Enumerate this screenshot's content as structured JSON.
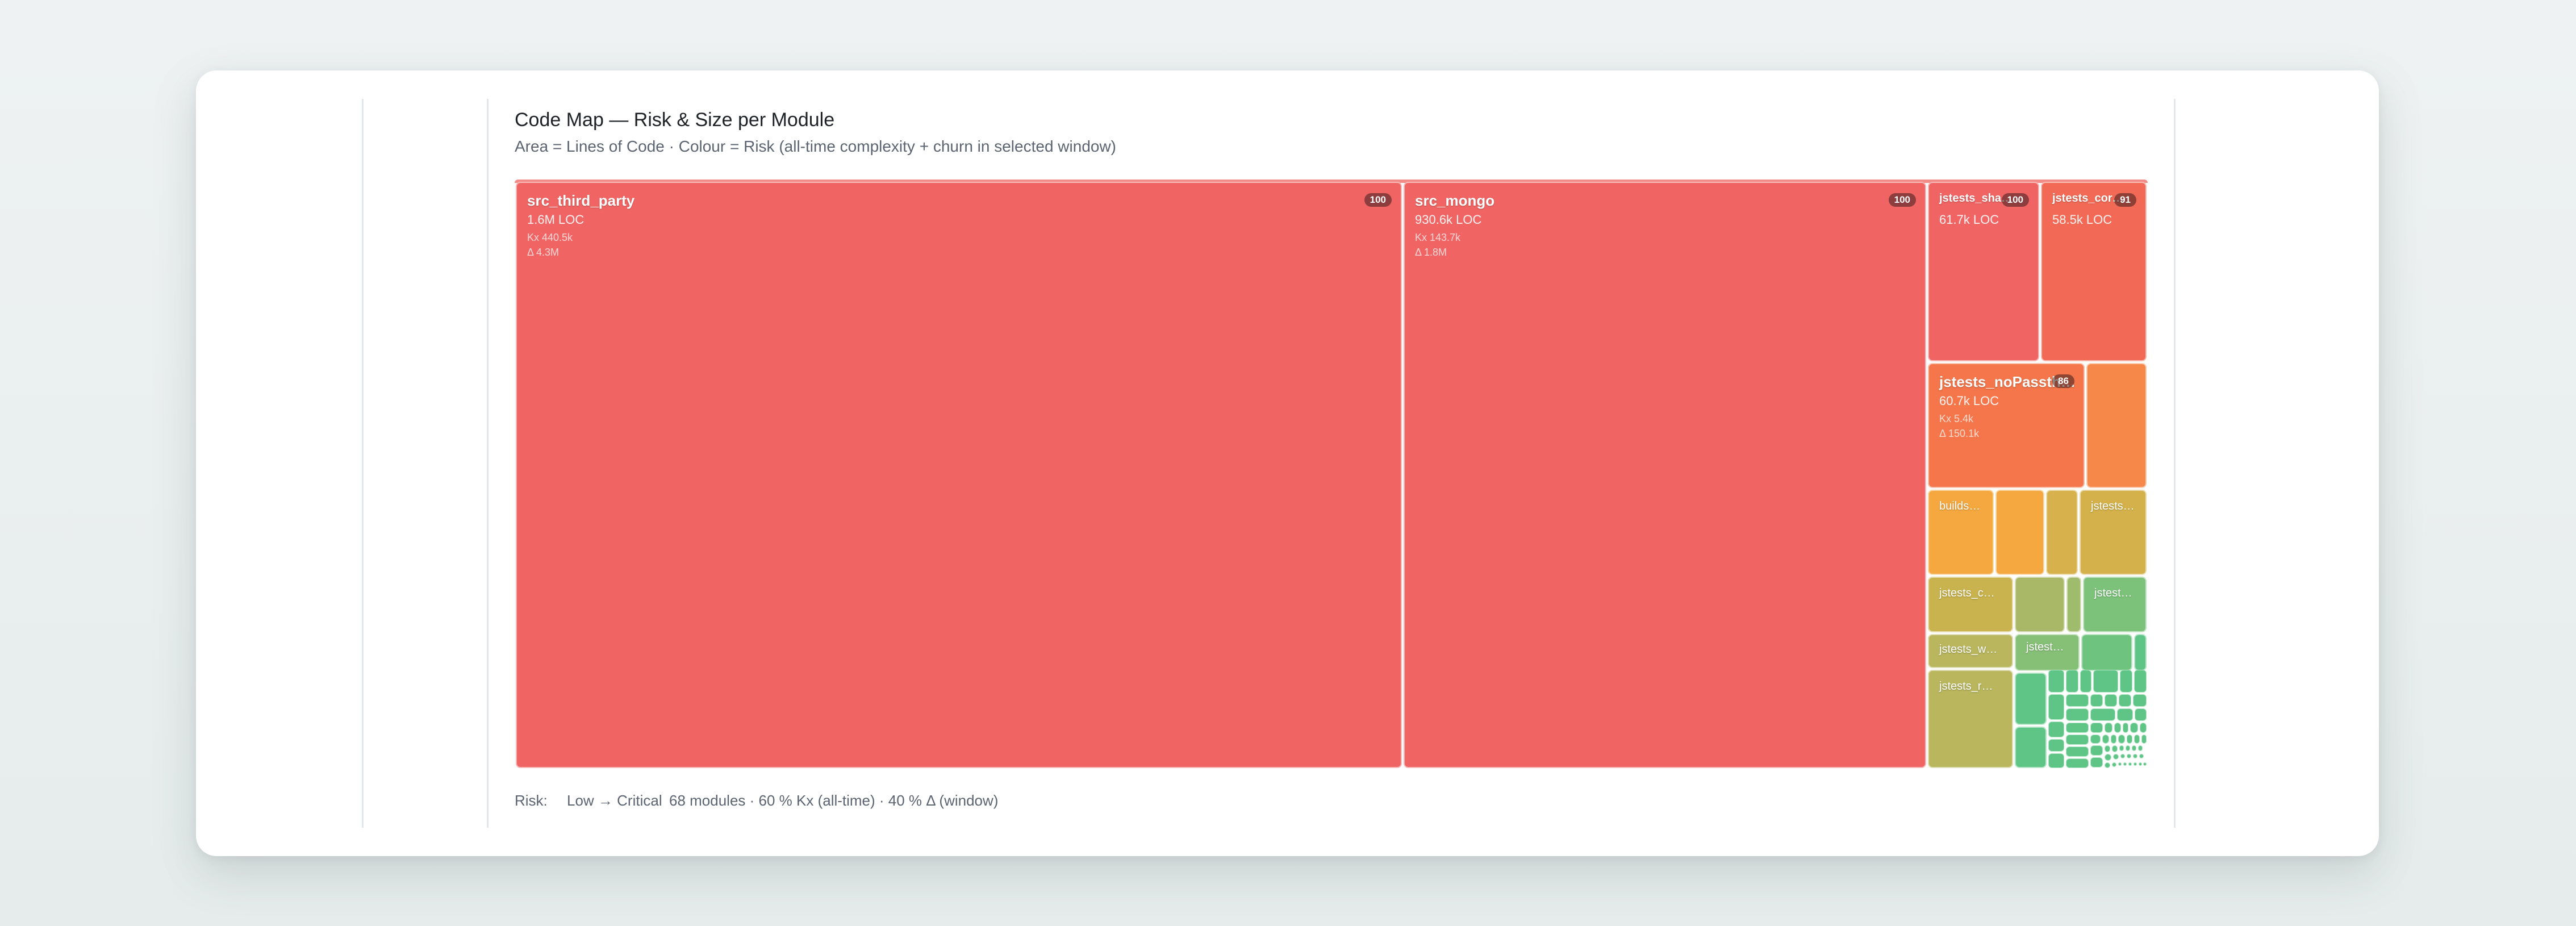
{
  "card": {
    "title": "Code Map — Risk & Size per Module",
    "subtitle": "Area = Lines of Code · Colour = Risk (all-time complexity + churn in selected window)"
  },
  "legend": {
    "risk_label": "Risk:",
    "scale_label": "Low → Critical",
    "summary": "68 modules · 60 % Kx (all-time) · 40 % Δ (window)"
  },
  "colors": {
    "critical": "#f06564",
    "high": "#f3694f",
    "elevated": "#f6894a",
    "medium": "#f5a83f",
    "moderate": "#d4b14b",
    "lowish": "#b9b65e",
    "low": "#9fbb6c",
    "minimal": "#5fc586"
  },
  "chart_data": {
    "type": "treemap",
    "title": "Code Map — Risk & Size per Module",
    "subtitle": "Area = Lines of Code · Colour = Risk (all-time complexity + churn in selected window)",
    "color_scale": "Low → Critical",
    "module_count": 68,
    "modules": [
      {
        "name": "src_third_party",
        "loc": "1.6M LOC",
        "kx": "Kx 440.5k",
        "delta": "Δ 4.3M",
        "risk": 100
      },
      {
        "name": "src_mongo",
        "loc": "930.6k LOC",
        "kx": "Kx 143.7k",
        "delta": "Δ 1.8M",
        "risk": 100
      },
      {
        "name": "jstests_sha…",
        "loc": "61.7k LOC",
        "risk": 100
      },
      {
        "name": "jstests_cor…",
        "loc": "58.5k LOC",
        "risk": 91
      },
      {
        "name": "jstests_noPassth…",
        "loc": "60.7k LOC",
        "kx": "Kx 5.4k",
        "delta": "Δ 150.1k",
        "risk": 86
      },
      {
        "name": "builds…"
      },
      {
        "name": "jstests…"
      },
      {
        "name": "jstests_c…"
      },
      {
        "name": "jstest…"
      },
      {
        "name": "jstests_w…"
      },
      {
        "name": "jstest…"
      },
      {
        "name": "jstests_r…"
      }
    ]
  }
}
